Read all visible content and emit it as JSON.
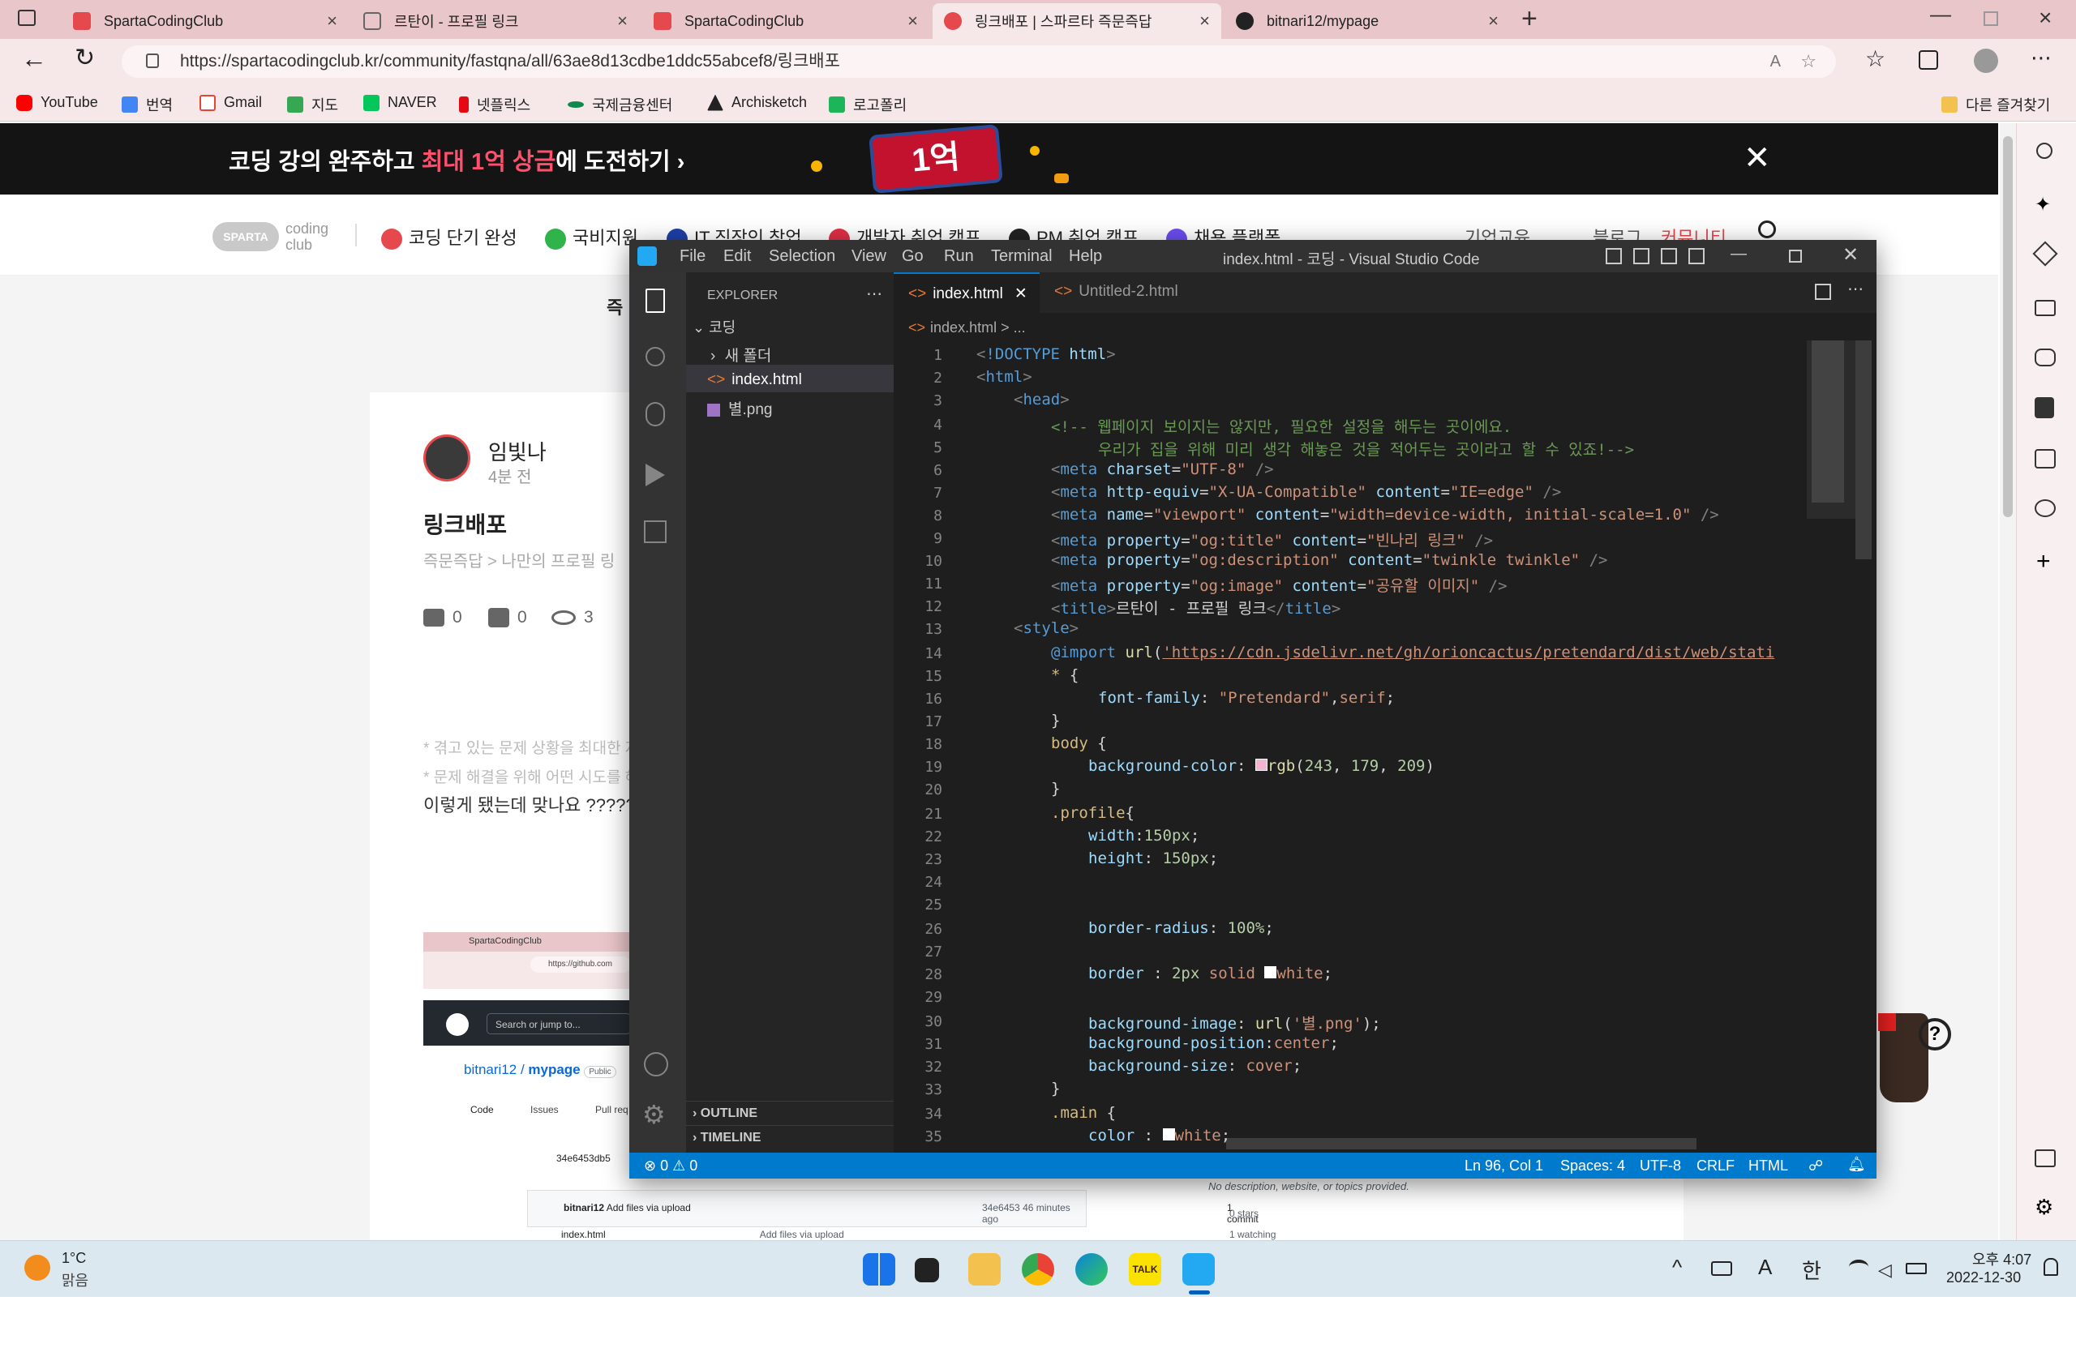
{
  "browser": {
    "tabs": [
      {
        "label": "SpartaCodingClub",
        "color": "#e5484d"
      },
      {
        "label": "르탄이 - 프로필 링크",
        "color": "#999999"
      },
      {
        "label": "SpartaCodingClub",
        "color": "#e5484d"
      },
      {
        "label": "링크배포 | 스파르타 즉문즉답",
        "color": "#e5484d"
      },
      {
        "label": "bitnari12/mypage",
        "color": "#222222"
      }
    ],
    "url": "https://spartacodingclub.kr/community/fastqna/all/63ae8d13cdbe1ddc55abcef8/링크배포",
    "bookmarks": [
      "YouTube",
      "번역",
      "Gmail",
      "지도",
      "NAVER",
      "넷플릭스",
      "국제금융센터",
      "Archisketch",
      "로고폴리"
    ],
    "other_bookmarks": "다른 즐겨찾기"
  },
  "page": {
    "banner_pre": "코딩 강의 완주하고 ",
    "banner_hl": "최대 1억 상금",
    "banner_post": "에 도전하기 ›",
    "banner_badge": "1억",
    "logo_top": "coding",
    "logo_bottom": "club",
    "logo_badge": "SPARTA",
    "nav": [
      "코딩 단기 완성",
      "국비지원",
      "IT 직장인 창업",
      "개발자 취업 캠프",
      "PM 취업 캠프",
      "채용 플랫폼",
      "기업교육",
      "블로그",
      "커뮤니티"
    ],
    "subnav_partial": "즉",
    "author": "임빛나",
    "time": "4분 전",
    "post_title": "링크배포",
    "breadcrumb": "즉문즉답 > 나만의 프로필 링",
    "stats": {
      "comments": "0",
      "likes": "0",
      "views": "3"
    },
    "hint1": "* 겪고 있는 문제 상황을 최대한 자",
    "hint2": "* 문제 해결을 위해 어떤 시도를 해",
    "question": "이렇게 됐는데 맞나요 ?????",
    "screenshot": {
      "tab": "SpartaCodingClub",
      "url": "https://github.com",
      "search": "Search or jump to...",
      "repo_owner": "bitnari12",
      "repo_name": "mypage",
      "public": "Public",
      "tabs": [
        "Code",
        "Issues",
        "Pull req"
      ],
      "branch": "34e6453db5",
      "commit_user": "bitnari12",
      "commit_msg": "Add files via upload",
      "commit_hash": "34e6453",
      "commit_time": "46 minutes ago",
      "commits": "1 commit",
      "file": "index.html",
      "file_msg": "Add files via upload",
      "file_time": "46 minutes ago",
      "about": "No description, website, or topics provided.",
      "stars": "0 stars",
      "watching": "1 watching"
    }
  },
  "vscode": {
    "title": "index.html - 코딩 - Visual Studio Code",
    "menu": [
      "File",
      "Edit",
      "Selection",
      "View",
      "Go",
      "Run",
      "Terminal",
      "Help"
    ],
    "explorer_title": "EXPLORER",
    "root": "코딩",
    "tree": [
      "새 폴더",
      "index.html",
      "별.png"
    ],
    "outline": "OUTLINE",
    "timeline": "TIMELINE",
    "tabs": [
      "index.html",
      "Untitled-2.html"
    ],
    "breadcrumb": "index.html > ...",
    "status": {
      "problems": "⊗ 0 ⚠ 0",
      "pos": "Ln 96, Col 1",
      "spaces": "Spaces: 4",
      "enc": "UTF-8",
      "eol": "CRLF",
      "lang": "HTML"
    },
    "swatches": {
      "pink": "#f3b3d1",
      "white": "#ffffff"
    }
  },
  "taskbar": {
    "temp": "1°C",
    "weather": "맑음",
    "time": "오후 4:07",
    "date": "2022-12-30",
    "ime": "한",
    "font_icon": "A"
  }
}
